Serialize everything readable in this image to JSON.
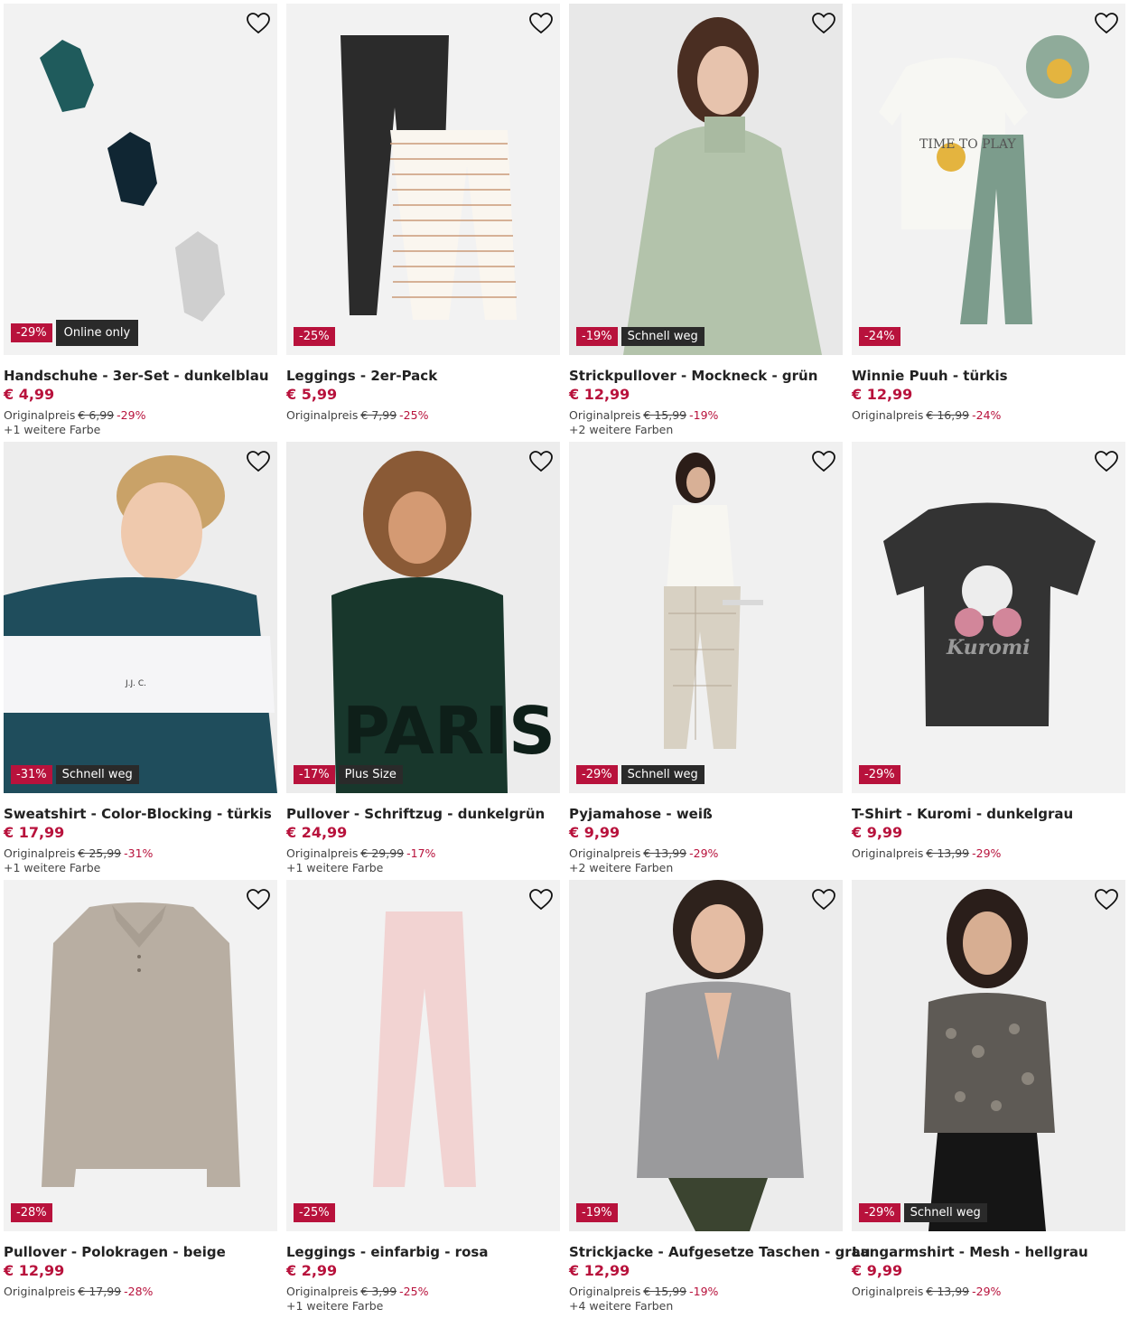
{
  "products": [
    {
      "title": "Handschuhe - 3er-Set - dunkelblau",
      "price": "€ 4,99",
      "orig_label": "Originalpreis",
      "orig_price": "€ 6,99",
      "discount": "-29%",
      "badge_discount": "-29%",
      "badge_tag": "Online only",
      "colors": "+1 weitere Farbe",
      "image": "gloves"
    },
    {
      "title": "Leggings - 2er-Pack",
      "price": "€ 5,99",
      "orig_label": "Originalpreis",
      "orig_price": "€ 7,99",
      "discount": "-25%",
      "badge_discount": "-25%",
      "badge_tag": "",
      "colors": "",
      "image": "leggings-pack"
    },
    {
      "title": "Strickpullover - Mockneck - grün",
      "price": "€ 12,99",
      "orig_label": "Originalpreis",
      "orig_price": "€ 15,99",
      "discount": "-19%",
      "badge_discount": "-19%",
      "badge_tag": "Schnell weg",
      "colors": "+2 weitere Farben",
      "image": "sweater-model"
    },
    {
      "title": "Winnie Puuh - türkis",
      "price": "€ 12,99",
      "orig_label": "Originalpreis",
      "orig_price": "€ 16,99",
      "discount": "-24%",
      "badge_discount": "-24%",
      "badge_tag": "",
      "colors": "",
      "image": "winnie-set"
    },
    {
      "title": "Sweatshirt - Color-Blocking - türkis",
      "price": "€ 17,99",
      "orig_label": "Originalpreis",
      "orig_price": "€ 25,99",
      "discount": "-31%",
      "badge_discount": "-31%",
      "badge_tag": "Schnell weg",
      "colors": "+1 weitere Farbe",
      "image": "hoodie-model"
    },
    {
      "title": "Pullover - Schriftzug - dunkelgrün",
      "price": "€ 24,99",
      "orig_label": "Originalpreis",
      "orig_price": "€ 29,99",
      "discount": "-17%",
      "badge_discount": "-17%",
      "badge_tag": "Plus Size",
      "colors": "+1 weitere Farbe",
      "image": "paris-model"
    },
    {
      "title": "Pyjamahose - weiß",
      "price": "€ 9,99",
      "orig_label": "Originalpreis",
      "orig_price": "€ 13,99",
      "discount": "-29%",
      "badge_discount": "-29%",
      "badge_tag": "Schnell weg",
      "colors": "+2 weitere Farben",
      "image": "pyjama-model"
    },
    {
      "title": "T-Shirt - Kuromi - dunkelgrau",
      "price": "€ 9,99",
      "orig_label": "Originalpreis",
      "orig_price": "€ 13,99",
      "discount": "-29%",
      "badge_discount": "-29%",
      "badge_tag": "",
      "colors": "",
      "image": "kuromi-tshirt"
    },
    {
      "title": "Pullover - Polokragen - beige",
      "price": "€ 12,99",
      "orig_label": "Originalpreis",
      "orig_price": "€ 17,99",
      "discount": "-28%",
      "badge_discount": "-28%",
      "badge_tag": "",
      "colors": "",
      "image": "polo-sweater"
    },
    {
      "title": "Leggings - einfarbig - rosa",
      "price": "€ 2,99",
      "orig_label": "Originalpreis",
      "orig_price": "€ 3,99",
      "discount": "-25%",
      "badge_discount": "-25%",
      "badge_tag": "",
      "colors": "+1 weitere Farbe",
      "image": "pink-leggings"
    },
    {
      "title": "Strickjacke - Aufgesetze Taschen - grau",
      "price": "€ 12,99",
      "orig_label": "Originalpreis",
      "orig_price": "€ 15,99",
      "discount": "-19%",
      "badge_discount": "-19%",
      "badge_tag": "",
      "colors": "+4 weitere Farben",
      "image": "cardigan-model"
    },
    {
      "title": "Langarmshirt - Mesh - hellgrau",
      "price": "€ 9,99",
      "orig_label": "Originalpreis",
      "orig_price": "€ 13,99",
      "discount": "-29%",
      "badge_discount": "-29%",
      "badge_tag": "Schnell weg",
      "colors": "",
      "image": "mesh-model"
    }
  ],
  "kuromi_print": "Kuromi",
  "paris_print": "PARIS",
  "winnie_print": "TIME TO PLAY",
  "colors": {
    "sale": "#b8123c",
    "tag_bg": "#2a2a2a",
    "image_bg": "#f2f2f2"
  }
}
